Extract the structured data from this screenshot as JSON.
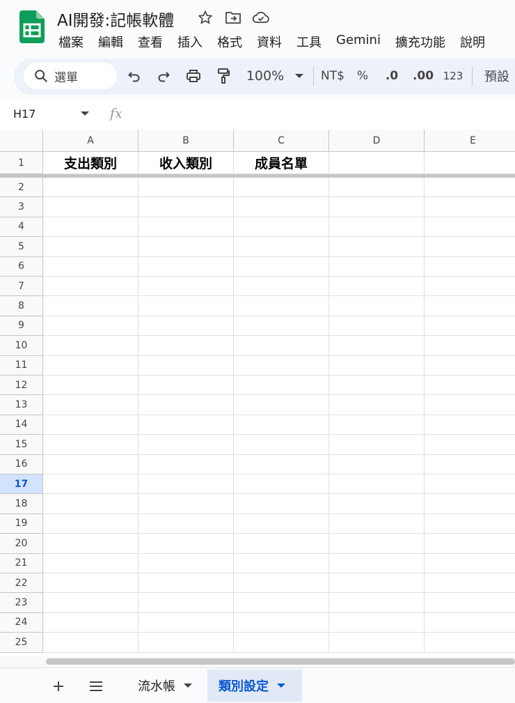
{
  "app": {
    "doc_title": "AI開發:記帳軟體",
    "menu": [
      "檔案",
      "編輯",
      "查看",
      "插入",
      "格式",
      "資料",
      "工具",
      "Gemini",
      "擴充功能",
      "說明"
    ]
  },
  "toolbar": {
    "search_label": "選單",
    "zoom": "100%",
    "currency": "NT$",
    "percent": "%",
    "dec_decrease": ".0",
    "dec_increase": ".00",
    "number_format": "123",
    "font_label": "預設"
  },
  "formula_bar": {
    "cell_ref": "H17",
    "fx_label": "fx"
  },
  "grid": {
    "columns": [
      "A",
      "B",
      "C",
      "D",
      "E"
    ],
    "rows": [
      "1",
      "2",
      "3",
      "4",
      "5",
      "6",
      "7",
      "8",
      "9",
      "10",
      "11",
      "12",
      "13",
      "14",
      "15",
      "16",
      "17",
      "18",
      "19",
      "20",
      "21",
      "22",
      "23",
      "24",
      "25"
    ],
    "selected_row": "17",
    "row1": [
      "支出類別",
      "收入類別",
      "成員名單",
      "",
      ""
    ]
  },
  "sheets": {
    "tabs": [
      {
        "label": "流水帳",
        "active": false
      },
      {
        "label": "類別設定",
        "active": true
      }
    ]
  },
  "colors": {
    "accent": "#0b57d0",
    "logo_green": "#0f9d58",
    "toolbar_bg": "#edf2fa"
  }
}
